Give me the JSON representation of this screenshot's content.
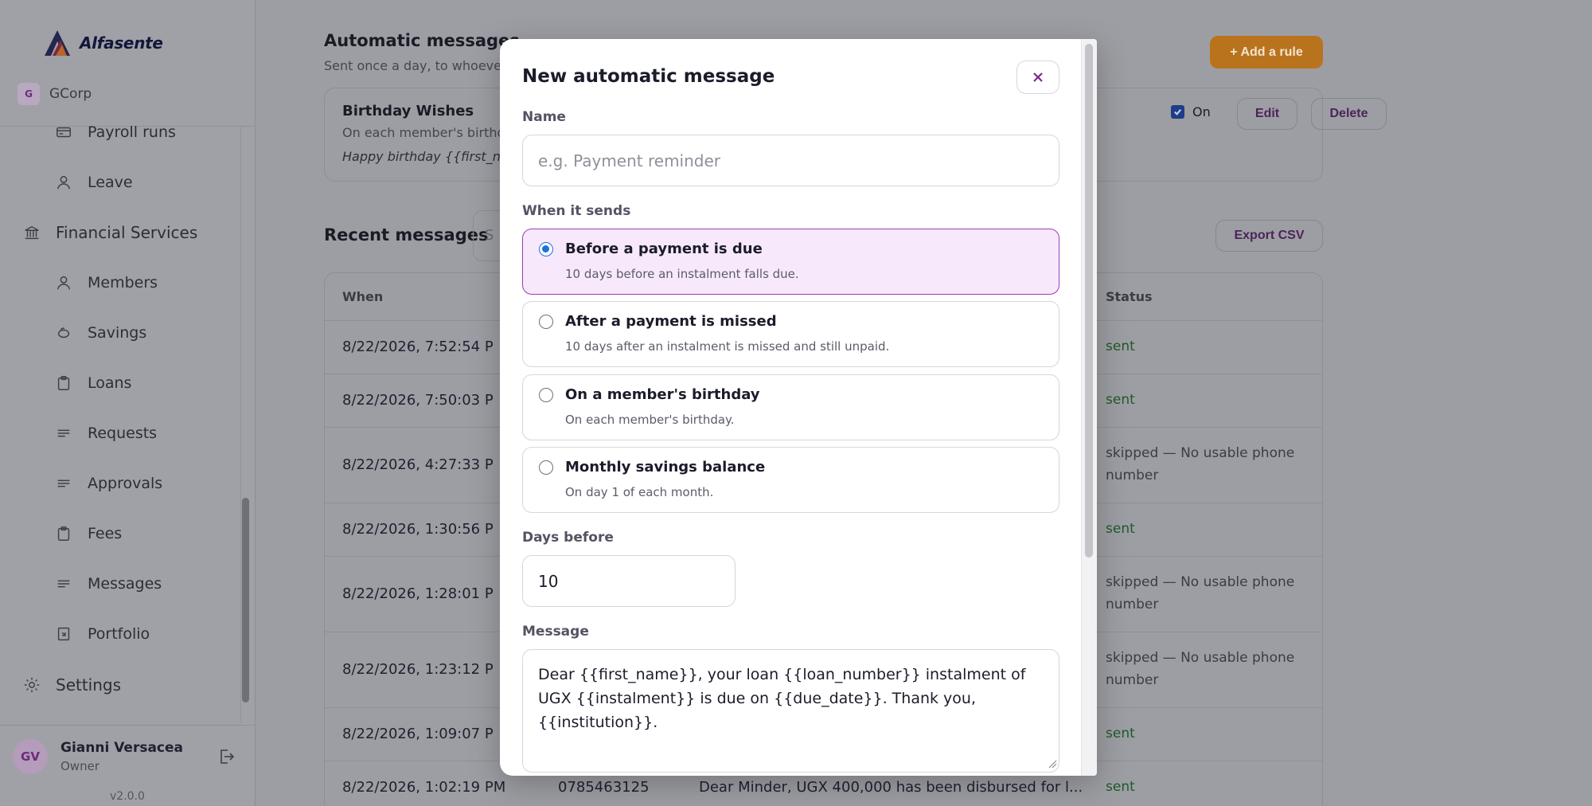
{
  "sidebar": {
    "brand": "Alfasente",
    "org_badge": "G",
    "org_name": "GCorp",
    "items": [
      {
        "label": "Payroll runs",
        "icon": "card-icon"
      },
      {
        "label": "Leave",
        "icon": "person-icon"
      },
      {
        "label": "Financial Services",
        "icon": "bank-icon"
      },
      {
        "label": "Members",
        "icon": "person-icon"
      },
      {
        "label": "Savings",
        "icon": "piggy-icon"
      },
      {
        "label": "Loans",
        "icon": "clipboard-icon"
      },
      {
        "label": "Requests",
        "icon": "lines-icon"
      },
      {
        "label": "Approvals",
        "icon": "lines-icon"
      },
      {
        "label": "Fees",
        "icon": "clipboard-icon"
      },
      {
        "label": "Messages",
        "icon": "lines-icon"
      },
      {
        "label": "Portfolio",
        "icon": "portfolio-icon"
      },
      {
        "label": "Settings",
        "icon": "gear-icon"
      }
    ],
    "user": {
      "initials": "GV",
      "name": "Gianni Versacea",
      "role": "Owner"
    },
    "version": "v2.0.0"
  },
  "automatic": {
    "title": "Automatic messages",
    "subtitle": "Sent once a day, to whoever",
    "add_label": "+ Add a rule",
    "rule": {
      "name": "Birthday Wishes",
      "when": "On each member's birthd",
      "message": "Happy birthday {{first_na",
      "enabled_label": "On",
      "edit_label": "Edit",
      "delete_label": "Delete"
    }
  },
  "recent": {
    "title": "Recent messages",
    "search_partial": "S",
    "export_label": "Export CSV",
    "columns": {
      "when": "When",
      "status": "Status"
    },
    "rows": [
      {
        "when": "8/22/2026, 7:52:54 P",
        "status": "sent"
      },
      {
        "when": "8/22/2026, 7:50:03 P",
        "status": "sent"
      },
      {
        "when": "8/22/2026, 4:27:33 P",
        "status": "skipped — No usable phone number"
      },
      {
        "when": "8/22/2026, 1:30:56 P",
        "status": "sent"
      },
      {
        "when": "8/22/2026, 1:28:01 P",
        "status": "skipped — No usable phone number"
      },
      {
        "when": "8/22/2026, 1:23:12 P",
        "status": "skipped — No usable phone number"
      },
      {
        "when": "8/22/2026, 1:09:07 P",
        "status": "sent"
      },
      {
        "when": "8/22/2026, 1:02:19 PM",
        "phone": "0785463125",
        "message": "Dear Minder, UGX 400,000 has been disbursed for l...",
        "status": "sent"
      }
    ]
  },
  "modal": {
    "title": "New automatic message",
    "name_label": "Name",
    "name_placeholder": "e.g. Payment reminder",
    "name_value": "",
    "when_label": "When it sends",
    "options": [
      {
        "title": "Before a payment is due",
        "desc": "10 days before an instalment falls due.",
        "selected": true
      },
      {
        "title": "After a payment is missed",
        "desc": "10 days after an instalment is missed and still unpaid.",
        "selected": false
      },
      {
        "title": "On a member's birthday",
        "desc": "On each member's birthday.",
        "selected": false
      },
      {
        "title": "Monthly savings balance",
        "desc": "On day 1 of each month.",
        "selected": false
      }
    ],
    "days_label": "Days before",
    "days_value": "10",
    "message_label": "Message",
    "message_value": "Dear {{first_name}}, your loan {{loan_number}} instalment of UGX {{instalment}} is due on {{due_date}}. Thank you, {{institution}}."
  }
}
